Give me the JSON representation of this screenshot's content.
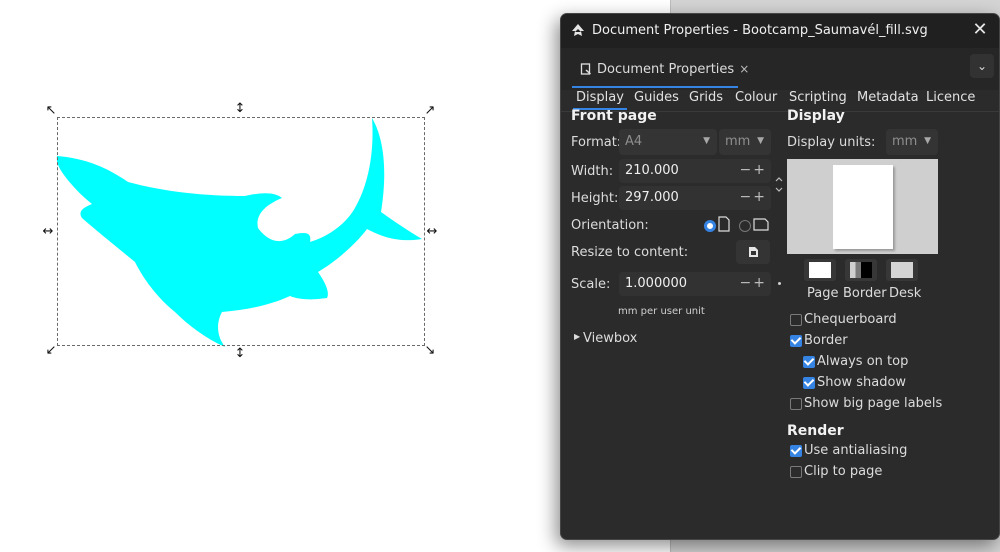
{
  "colors": {
    "shark_fill": "#00ffff",
    "accent": "#3584e4",
    "dialog_bg": "#2b2b2b"
  },
  "canvas": {
    "shape_name": "shark",
    "handles": [
      "↖",
      "↕",
      "↗",
      "↔",
      "↔",
      "↙",
      "↕",
      "↘"
    ]
  },
  "window": {
    "title": "Document Properties - Bootcamp_Saumavél_fill.svg",
    "close_icon": "✕"
  },
  "dock": {
    "tab_label": "Document Properties",
    "tab_close": "×",
    "menu_icon": "⌄"
  },
  "tabs": [
    "Display",
    "Guides",
    "Grids",
    "Colour",
    "Scripting",
    "Metadata",
    "Licence"
  ],
  "front_page": {
    "heading": "Front page",
    "format_label": "Format:",
    "format_value": "A4",
    "unit_value": "mm",
    "width_label": "Width:",
    "width_value": "210.000",
    "height_label": "Height:",
    "height_value": "297.000",
    "spin": "−+",
    "orientation_label": "Orientation:",
    "resize_label": "Resize to content:",
    "scale_label": "Scale:",
    "scale_value": "1.000000",
    "scale_note": "mm per user unit",
    "viewbox_label": "Viewbox"
  },
  "display": {
    "heading": "Display",
    "units_label": "Display units:",
    "units_value": "mm",
    "swatches": [
      {
        "label": "Page"
      },
      {
        "label": "Border"
      },
      {
        "label": "Desk"
      }
    ],
    "checks": [
      {
        "label": "Chequerboard",
        "checked": false
      },
      {
        "label": "Border",
        "checked": true
      },
      {
        "label": "Always on top",
        "checked": true
      },
      {
        "label": "Show shadow",
        "checked": true
      },
      {
        "label": "Show big page labels",
        "checked": false
      }
    ]
  },
  "render": {
    "heading": "Render",
    "checks": [
      {
        "label": "Use antialiasing",
        "checked": true
      },
      {
        "label": "Clip to page",
        "checked": false
      }
    ]
  }
}
